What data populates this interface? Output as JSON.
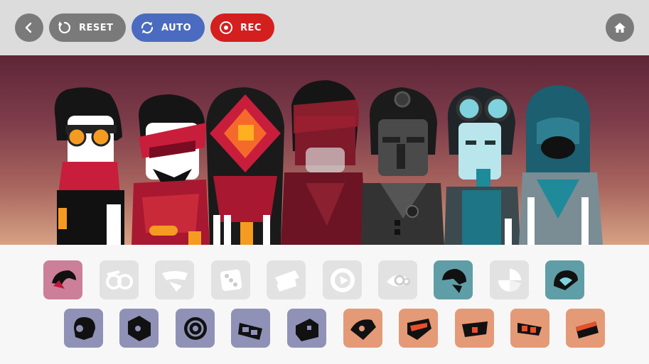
{
  "toolbar": {
    "reset_label": "RESET",
    "auto_label": "AUTO",
    "rec_label": "REC"
  },
  "colors": {
    "gray_button": "#7a7a7a",
    "auto_button": "#4a6bbf",
    "rec_button": "#d41f1f",
    "tile_pink": "#cc7f98",
    "tile_gray": "#e2e2e2",
    "tile_teal": "#5f9ea6",
    "tile_purple": "#8f91b6",
    "tile_orange": "#e49a76"
  },
  "stage": {
    "characters": [
      {
        "name": "character-1",
        "style": "orange-goggles-red-scarf"
      },
      {
        "name": "character-2",
        "style": "red-headband-beard"
      },
      {
        "name": "character-3",
        "style": "red-diamond-mask"
      },
      {
        "name": "character-4",
        "style": "shadowed-dark-red"
      },
      {
        "name": "character-5",
        "style": "dark-gray-headlamp"
      },
      {
        "name": "character-6",
        "style": "teal-goggles"
      },
      {
        "name": "character-7",
        "style": "teal-hooded"
      }
    ]
  },
  "sound_icons": {
    "row1": [
      {
        "name": "pink-hair-icon",
        "color": "pink"
      },
      {
        "name": "glasses-icon",
        "color": "gray"
      },
      {
        "name": "scarf-icon",
        "color": "gray"
      },
      {
        "name": "dice-icon",
        "color": "gray"
      },
      {
        "name": "ribbon-icon",
        "color": "gray"
      },
      {
        "name": "ring-icon",
        "color": "gray"
      },
      {
        "name": "gear-eye-icon",
        "color": "gray"
      },
      {
        "name": "teal-helmet-icon",
        "color": "teal"
      },
      {
        "name": "split-circle-icon",
        "color": "gray"
      },
      {
        "name": "teal-hood-icon",
        "color": "teal"
      }
    ],
    "row2": [
      {
        "name": "purple-mask-icon",
        "color": "purple"
      },
      {
        "name": "purple-hex-icon",
        "color": "purple"
      },
      {
        "name": "purple-target-icon",
        "color": "purple"
      },
      {
        "name": "purple-goggles-icon",
        "color": "purple"
      },
      {
        "name": "purple-cap-icon",
        "color": "purple"
      },
      {
        "name": "orange-eye-icon",
        "color": "orange"
      },
      {
        "name": "orange-visor-icon",
        "color": "orange"
      },
      {
        "name": "orange-band-icon",
        "color": "orange"
      },
      {
        "name": "orange-glasses-icon",
        "color": "orange"
      },
      {
        "name": "orange-hat-icon",
        "color": "orange"
      }
    ]
  }
}
